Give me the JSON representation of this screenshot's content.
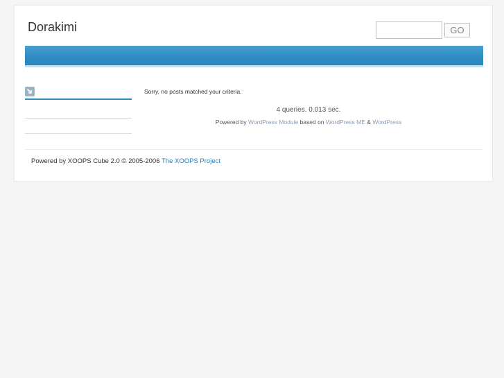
{
  "header": {
    "site_title": "Dorakimi",
    "search": {
      "value": "",
      "placeholder": ""
    },
    "go_label": "GO"
  },
  "sidebar": {
    "block_icon": "arrow-icon"
  },
  "main": {
    "no_posts": "Sorry, no posts matched your criteria.",
    "queries": "4 queries. 0.013 sec.",
    "powered": {
      "prefix": "Powered by",
      "wp_module_link": "WordPress Module",
      "based_on": "based on",
      "wp_me_link": "WordPress ME",
      "amp": "&",
      "wp_link": "WordPress"
    }
  },
  "footer": {
    "text": "Powered by XOOPS Cube 2.0 © 2005-2006",
    "xoops_link": "The XOOPS Project"
  },
  "colors": {
    "nav_bar": "#2e8bc3",
    "link": "#2a7ab5",
    "muted_link": "#8a9bb0"
  }
}
